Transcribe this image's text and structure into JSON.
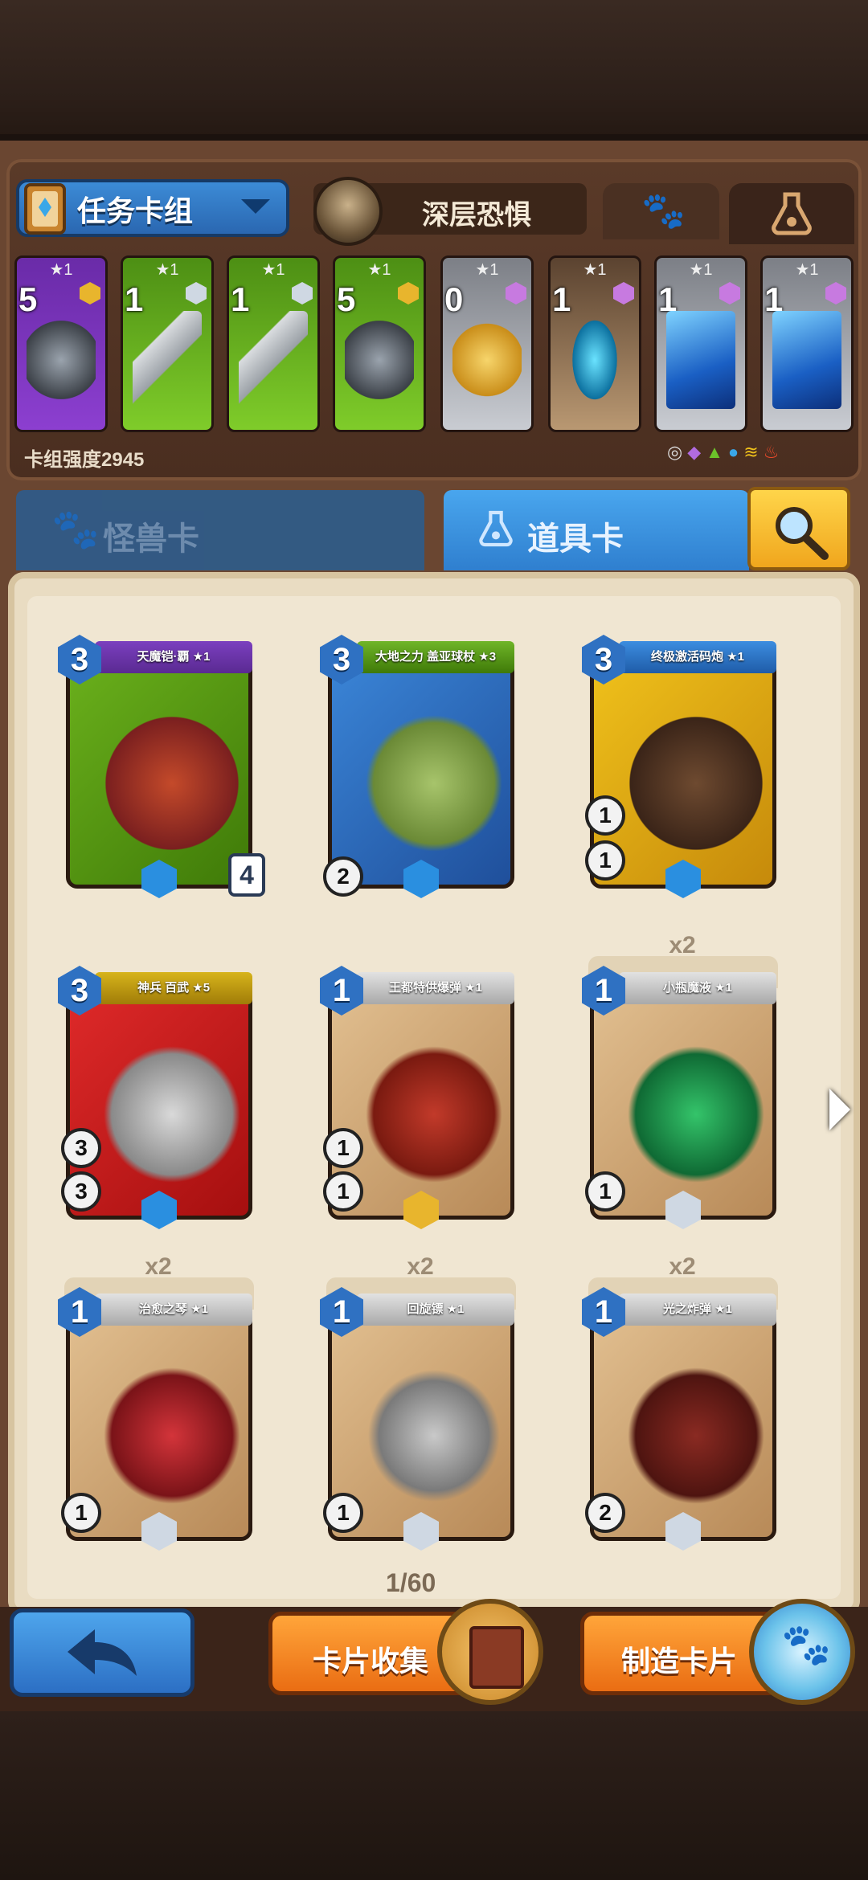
{
  "deck": {
    "selector_label": "任务卡组",
    "title": "深层恐惧",
    "strength": "卡组强度2945",
    "slots": [
      {
        "stars": "★1",
        "count": "5",
        "color": "purple",
        "gem": "#e8b52d"
      },
      {
        "stars": "★1",
        "count": "1",
        "color": "green",
        "gem": "#cfd8e3"
      },
      {
        "stars": "★1",
        "count": "1",
        "color": "green",
        "gem": "#cfd8e3"
      },
      {
        "stars": "★1",
        "count": "5",
        "color": "green",
        "gem": "#e8b52d"
      },
      {
        "stars": "★1",
        "count": "0",
        "color": "grey",
        "gem": "#c77ae0"
      },
      {
        "stars": "★1",
        "count": "1",
        "color": "tan",
        "gem": "#c77ae0"
      },
      {
        "stars": "★1",
        "count": "1",
        "color": "grey",
        "gem": "#c77ae0"
      },
      {
        "stars": "★1",
        "count": "1",
        "color": "grey",
        "gem": "#c77ae0"
      }
    ]
  },
  "tabs": {
    "monster": "怪兽卡",
    "item": "道具卡"
  },
  "cards": [
    {
      "name": "天魔铠·覇 ★1",
      "cost": "3",
      "frame": "green",
      "banner": "purple",
      "bl1": "",
      "bl2": "",
      "badge": "4",
      "dup": ""
    },
    {
      "name": "大地之力 盖亚球杖 ★3",
      "cost": "3",
      "frame": "blue",
      "banner": "green",
      "bl1": "",
      "bl2": "2",
      "badge": "",
      "dup": ""
    },
    {
      "name": "终极激活码炮 ★1",
      "cost": "3",
      "frame": "yellow",
      "banner": "blue",
      "bl1": "1",
      "bl2": "1",
      "badge": "",
      "dup": ""
    },
    {
      "name": "神兵 百武 ★5",
      "cost": "3",
      "frame": "red",
      "banner": "yellow",
      "bl1": "3",
      "bl2": "3",
      "badge": "",
      "dup": ""
    },
    {
      "name": "王都特供爆弹 ★1",
      "cost": "1",
      "frame": "tan",
      "banner": "grey",
      "bl1": "1",
      "bl2": "1",
      "badge": "",
      "dup": ""
    },
    {
      "name": "小瓶魔液 ★1",
      "cost": "1",
      "frame": "tan",
      "banner": "grey",
      "bl1": "",
      "bl2": "1",
      "badge": "",
      "dup": "x2"
    },
    {
      "name": "治愈之琴 ★1",
      "cost": "1",
      "frame": "tan",
      "banner": "grey",
      "bl1": "",
      "bl2": "1",
      "badge": "",
      "dup": "x2"
    },
    {
      "name": "回旋镖 ★1",
      "cost": "1",
      "frame": "tan",
      "banner": "grey",
      "bl1": "",
      "bl2": "1",
      "badge": "",
      "dup": "x2"
    },
    {
      "name": "光之炸弹 ★1",
      "cost": "1",
      "frame": "tan",
      "banner": "grey",
      "bl1": "",
      "bl2": "2",
      "badge": "",
      "dup": "x2"
    }
  ],
  "pager": "1/60",
  "buttons": {
    "collection": "卡片收集",
    "craft": "制造卡片"
  },
  "colors": {
    "accent_blue": "#2f7fcf",
    "accent_orange": "#ea6d13",
    "parchment": "#f0e6d2"
  }
}
